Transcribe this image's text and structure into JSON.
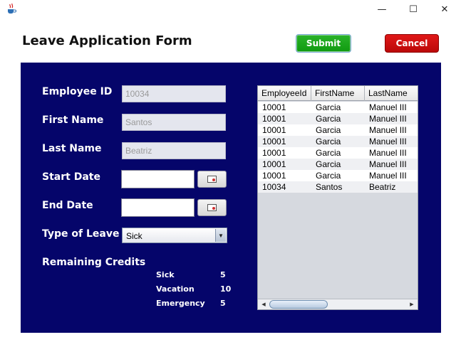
{
  "window": {
    "icon": "java-cup-icon",
    "controls": {
      "minimize": "—",
      "maximize": "☐",
      "close": "✕"
    }
  },
  "form": {
    "title": "Leave Application Form",
    "submit_label": "Submit",
    "cancel_label": "Cancel"
  },
  "fields": {
    "employee_id": {
      "label": "Employee ID",
      "value": "10034"
    },
    "first_name": {
      "label": "First Name",
      "value": "Santos"
    },
    "last_name": {
      "label": "Last Name",
      "value": "Beatriz"
    },
    "start_date": {
      "label": "Start Date",
      "value": ""
    },
    "end_date": {
      "label": "End Date",
      "value": ""
    },
    "leave_type": {
      "label": "Type of Leave",
      "selected": "Sick"
    }
  },
  "credits": {
    "title": "Remaining Credits",
    "items": [
      {
        "name": "Sick",
        "value": "5"
      },
      {
        "name": "Vacation",
        "value": "10"
      },
      {
        "name": "Emergency",
        "value": "5"
      }
    ]
  },
  "table": {
    "columns": [
      "EmployeeId",
      "FirstName",
      "LastName"
    ],
    "rows": [
      [
        "10001",
        "Garcia",
        "Manuel III"
      ],
      [
        "10001",
        "Garcia",
        "Manuel III"
      ],
      [
        "10001",
        "Garcia",
        "Manuel III"
      ],
      [
        "10001",
        "Garcia",
        "Manuel III"
      ],
      [
        "10001",
        "Garcia",
        "Manuel III"
      ],
      [
        "10001",
        "Garcia",
        "Manuel III"
      ],
      [
        "10001",
        "Garcia",
        "Manuel III"
      ],
      [
        "10034",
        "Santos",
        "Beatriz"
      ]
    ]
  },
  "colors": {
    "panel": "#05056a",
    "submit": "#1aa61a",
    "cancel": "#cc0c0c"
  }
}
